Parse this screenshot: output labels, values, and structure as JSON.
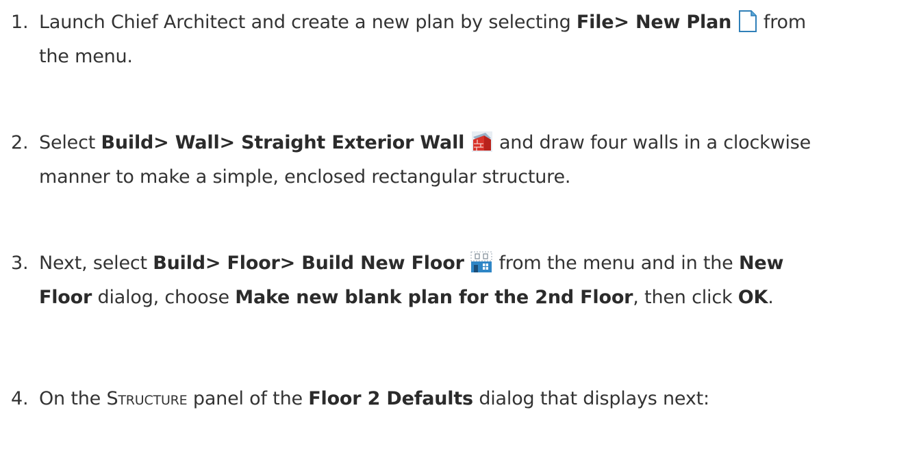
{
  "steps": [
    {
      "number": "1.",
      "line1": {
        "pre": "Launch Chief Architect and create a new plan by selecting ",
        "bold1": "File> New Plan",
        "post": " from"
      },
      "line2": "the menu.",
      "icon": "new-plan-icon"
    },
    {
      "number": "2.",
      "line1": {
        "pre": "Select ",
        "bold1": "Build> Wall> Straight Exterior Wall",
        "post": " and draw four walls in a clockwise"
      },
      "line2": "manner to make a simple, enclosed rectangular structure.",
      "icon": "exterior-wall-icon"
    },
    {
      "number": "3.",
      "line1": {
        "pre": "Next, select ",
        "bold1": "Build> Floor> Build New Floor",
        "mid": " from the menu and in the ",
        "bold2": "New"
      },
      "line2": {
        "bold1": "Floor",
        "mid1": " dialog, choose ",
        "bold2": "Make new blank plan for the 2nd Floor",
        "mid2": ", then click ",
        "bold3": "OK",
        "end": "."
      },
      "icon": "build-new-floor-icon"
    },
    {
      "number": "4.",
      "line1": {
        "pre": "On the ",
        "smallcaps": "Structure",
        "mid": " panel of the ",
        "bold1": "Floor 2 Defaults",
        "post": " dialog that displays next:"
      },
      "icon": null
    }
  ]
}
